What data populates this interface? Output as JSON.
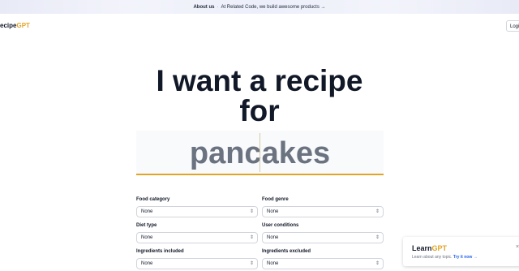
{
  "banner": {
    "about": "About us",
    "separator": "·",
    "text": "At Related Code, we build awesome products →"
  },
  "header": {
    "logo_main": "ecipe",
    "logo_accent": "GPT",
    "login_label": "Logi"
  },
  "hero": {
    "line1": "I want a recipe",
    "line2": "for",
    "food_value": "pancakes"
  },
  "form": {
    "food_category": {
      "label": "Food category",
      "value": "None",
      "chevron": "⇕"
    },
    "food_genre": {
      "label": "Food genre",
      "value": "None",
      "chevron": "⇕"
    },
    "diet_type": {
      "label": "Diet type",
      "value": "None",
      "chevron": "⇕"
    },
    "user_conditions": {
      "label": "User conditions",
      "value": "None",
      "chevron": "⇕"
    },
    "ingredients_included": {
      "label": "Ingredients included",
      "value": "None",
      "chevron": "⇕"
    },
    "ingredients_excluded": {
      "label": "Ingredients excluded",
      "value": "None",
      "chevron": "⇕"
    }
  },
  "toast": {
    "title_main": "Learn",
    "title_accent": "GPT",
    "subtitle": "Learn about any topic.",
    "link": "Try it now →",
    "close": "×"
  },
  "colors": {
    "accent": "#e0a526",
    "link": "#2563eb",
    "text": "#111827",
    "muted": "#6b7280"
  }
}
